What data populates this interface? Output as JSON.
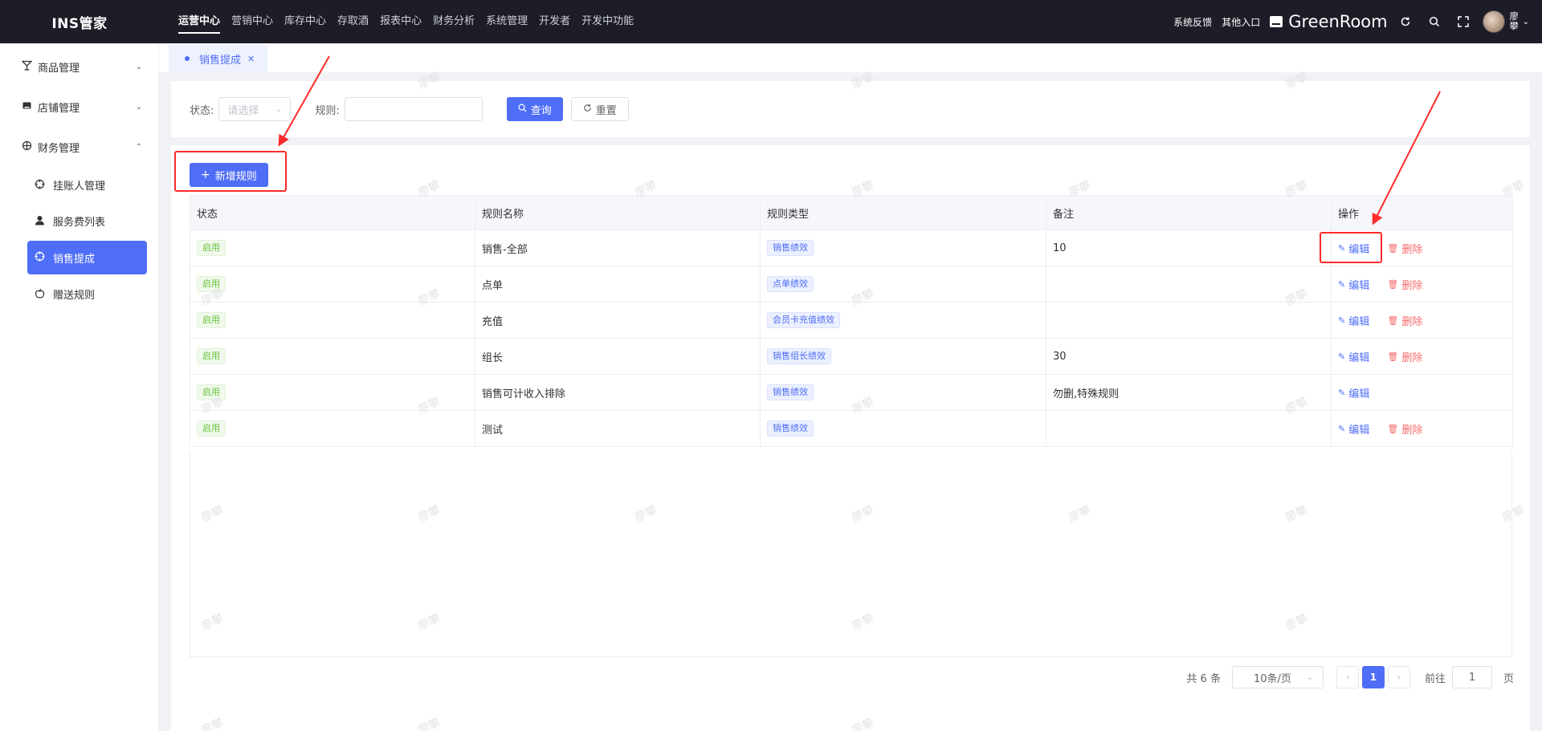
{
  "header": {
    "logo": "INS管家",
    "nav": [
      "运营中心",
      "营销中心",
      "库存中心",
      "存取酒",
      "报表中心",
      "财务分析",
      "系统管理",
      "开发者",
      "开发中功能"
    ],
    "active_nav": "运营中心",
    "feedback": "系统反馈",
    "other_entry": "其他入口",
    "store_name": "GreenRoom",
    "user_name": "廖攀"
  },
  "sidebar": {
    "groups": [
      {
        "label": "商品管理",
        "icon": "cocktail-icon",
        "expanded": false
      },
      {
        "label": "店铺管理",
        "icon": "store-icon",
        "expanded": false
      },
      {
        "label": "财务管理",
        "icon": "finance-icon",
        "expanded": true
      }
    ],
    "sub_items": [
      {
        "label": "挂账人管理",
        "icon": "crosshair-icon"
      },
      {
        "label": "服务费列表",
        "icon": "user-icon"
      },
      {
        "label": "销售提成",
        "icon": "crosshair-icon",
        "active": true
      },
      {
        "label": "赠送规则",
        "icon": "apple-icon"
      }
    ]
  },
  "tabs": [
    {
      "label": "销售提成",
      "active": true
    }
  ],
  "filter": {
    "status_label": "状态:",
    "status_placeholder": "请选择",
    "rule_label": "规则:",
    "rule_value": "",
    "search_label": "查询",
    "reset_label": "重置"
  },
  "toolbar": {
    "add_label": "新增规则"
  },
  "table": {
    "headers": [
      "状态",
      "规则名称",
      "规则类型",
      "备注",
      "操作"
    ],
    "rows": [
      {
        "status": "启用",
        "name": "销售-全部",
        "type": "销售绩效",
        "note": "10",
        "can_delete": true
      },
      {
        "status": "启用",
        "name": "点单",
        "type": "点单绩效",
        "note": "",
        "can_delete": true
      },
      {
        "status": "启用",
        "name": "充值",
        "type": "会员卡充值绩效",
        "note": "",
        "can_delete": true
      },
      {
        "status": "启用",
        "name": "组长",
        "type": "销售组长绩效",
        "note": "30",
        "can_delete": true
      },
      {
        "status": "启用",
        "name": "销售可计收入排除",
        "type": "销售绩效",
        "note": "勿删,特殊规则",
        "can_delete": false
      },
      {
        "status": "启用",
        "name": "测试",
        "type": "销售绩效",
        "note": "",
        "can_delete": true
      }
    ],
    "edit_label": "编辑",
    "delete_label": "删除"
  },
  "pagination": {
    "total": "共 6 条",
    "page_size": "10条/页",
    "current_page": "1",
    "goto_label": "前往",
    "goto_value": "1",
    "page_suffix": "页"
  },
  "watermark": "廖攀",
  "colors": {
    "accent": "#4f6ef7",
    "danger": "#f56c6c",
    "success": "#67c23a",
    "annotation": "#ff2a2a",
    "topbar": "#1c1d27"
  }
}
